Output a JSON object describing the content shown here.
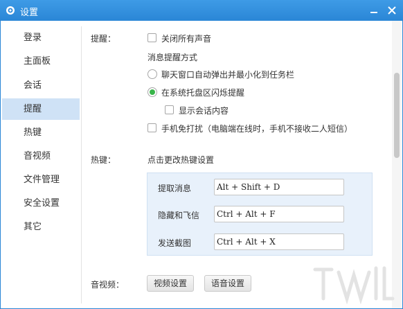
{
  "window": {
    "title": "设置"
  },
  "sidebar": {
    "items": [
      {
        "label": "登录"
      },
      {
        "label": "主面板"
      },
      {
        "label": "会话"
      },
      {
        "label": "提醒",
        "active": true
      },
      {
        "label": "热键"
      },
      {
        "label": "音视频"
      },
      {
        "label": "文件管理"
      },
      {
        "label": "安全设置"
      },
      {
        "label": "其它"
      }
    ]
  },
  "reminder": {
    "section_label": "提醒：",
    "mute_all": {
      "label": "关闭所有声音",
      "checked": false
    },
    "method_label": "消息提醒方式",
    "popup_option": {
      "label": "聊天窗口自动弹出并最小化到任务栏",
      "selected": false
    },
    "tray_flash_option": {
      "label": "在系统托盘区闪烁提醒",
      "selected": true
    },
    "show_content": {
      "label": "显示会话内容",
      "checked": false
    },
    "mobile_dnd": {
      "label": "手机免打扰（电脑端在线时，手机不接收二人短信）",
      "checked": false
    }
  },
  "hotkeys": {
    "section_label": "热键：",
    "hint": "点击更改热键设置",
    "items": [
      {
        "label": "提取消息",
        "value": "Alt + Shift + D"
      },
      {
        "label": "隐藏和飞信",
        "value": "Ctrl + Alt + F"
      },
      {
        "label": "发送截图",
        "value": "Ctrl + Alt + X"
      }
    ]
  },
  "av": {
    "section_label": "音视频：",
    "video_button": "视频设置",
    "audio_button": "语音设置"
  },
  "colors": {
    "titlebar": "#2a86d6",
    "selected_item": "#cfe2f6",
    "radio_checked": "#39b54a",
    "hotkey_panel": "#e8f1fb"
  }
}
